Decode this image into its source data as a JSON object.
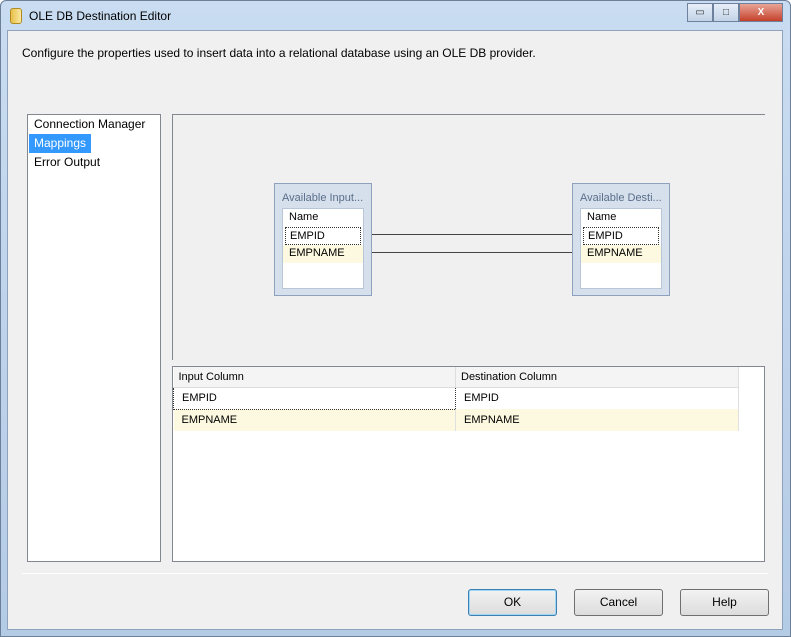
{
  "window": {
    "title": "OLE DB Destination Editor",
    "minimize": "▭",
    "maximize": "□",
    "close": "X"
  },
  "description": "Configure the properties used to insert data into a relational database using an OLE DB provider.",
  "nav": {
    "items": [
      {
        "label": "Connection Manager"
      },
      {
        "label": "Mappings",
        "selected": true
      },
      {
        "label": "Error Output"
      }
    ]
  },
  "diagram": {
    "input": {
      "title": "Available Input...",
      "header": "Name",
      "columns": [
        "EMPID",
        "EMPNAME"
      ]
    },
    "destination": {
      "title": "Available Desti...",
      "header": "Name",
      "columns": [
        "EMPID",
        "EMPNAME"
      ]
    }
  },
  "grid": {
    "headers": [
      "Input Column",
      "Destination Column"
    ],
    "rows": [
      [
        "EMPID",
        "EMPID"
      ],
      [
        "EMPNAME",
        "EMPNAME"
      ]
    ]
  },
  "buttons": {
    "ok": "OK",
    "cancel": "Cancel",
    "help": "Help"
  }
}
